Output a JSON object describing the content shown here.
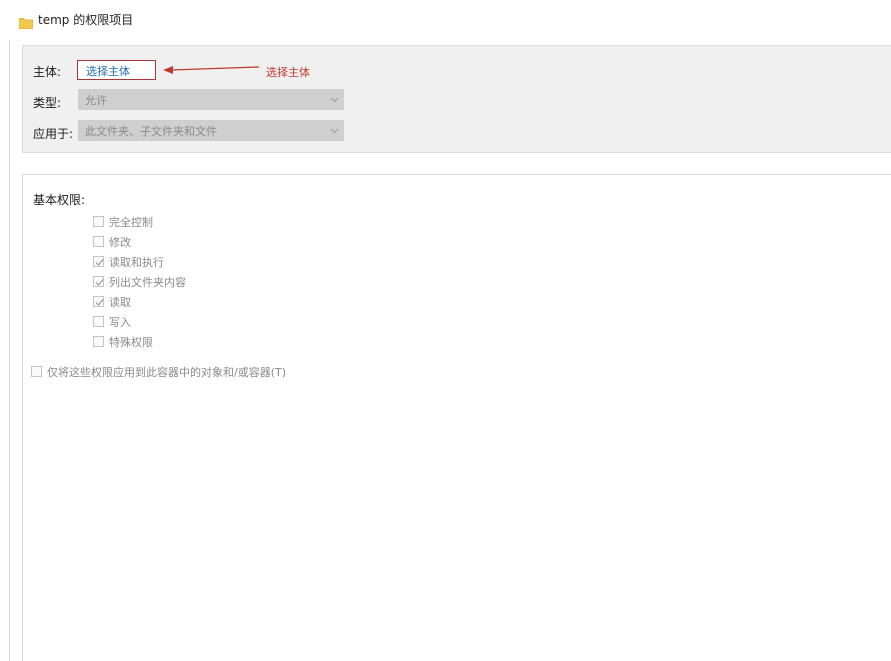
{
  "window": {
    "title": "temp 的权限项目"
  },
  "principal": {
    "label": "主体:",
    "link_label": "选择主体",
    "annotation": "选择主体"
  },
  "type": {
    "label": "类型:",
    "value": "允许"
  },
  "applies_to": {
    "label": "应用于:",
    "value": "此文件夹、子文件夹和文件"
  },
  "basic_permissions": {
    "label": "基本权限:",
    "items": [
      {
        "label": "完全控制",
        "checked": false
      },
      {
        "label": "修改",
        "checked": false
      },
      {
        "label": "读取和执行",
        "checked": true
      },
      {
        "label": "列出文件夹内容",
        "checked": true
      },
      {
        "label": "读取",
        "checked": true
      },
      {
        "label": "写入",
        "checked": false
      },
      {
        "label": "特殊权限",
        "checked": false
      }
    ]
  },
  "apply_only_container": {
    "label": "仅将这些权限应用到此容器中的对象和/或容器(T)",
    "checked": false
  },
  "icons": {
    "folder": "folder-icon",
    "arrow": "arrow-left-icon",
    "dropdown": "chevron-down-icon",
    "check": "checkmark-icon"
  },
  "colors": {
    "annotation": "#c0392b",
    "link": "#1f6fb8",
    "disabled_text": "#8a8a8a",
    "disabled_combo": "#cfcfcf",
    "folder": "#f2c94c"
  }
}
